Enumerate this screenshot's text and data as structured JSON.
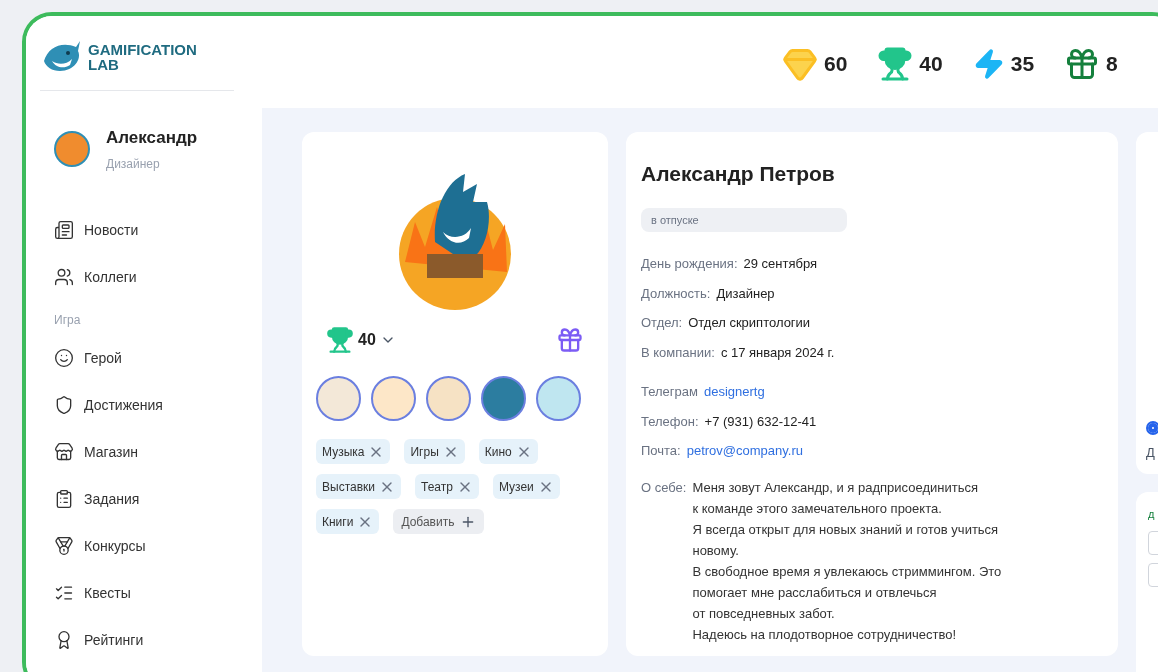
{
  "logo": {
    "line1": "GAMIFICATION",
    "line2": "LAB"
  },
  "user": {
    "name": "Александр",
    "role": "Дизайнер"
  },
  "nav": [
    {
      "items": [
        {
          "label": "Новости"
        },
        {
          "label": "Коллеги"
        }
      ]
    },
    {
      "label": "Игра",
      "items": [
        {
          "label": "Герой"
        },
        {
          "label": "Достижения"
        },
        {
          "label": "Магазин"
        },
        {
          "label": "Задания"
        },
        {
          "label": "Конкурсы"
        },
        {
          "label": "Квесты"
        },
        {
          "label": "Рейтинги"
        }
      ]
    }
  ],
  "counters": [
    {
      "kind": "gem",
      "value": "60"
    },
    {
      "kind": "trophy",
      "value": "40"
    },
    {
      "kind": "bolt",
      "value": "35"
    },
    {
      "kind": "gift",
      "value": "8"
    }
  ],
  "profile": {
    "trophies": "40",
    "tags": [
      {
        "label": "Музыка"
      },
      {
        "label": "Игры"
      },
      {
        "label": "Кино"
      },
      {
        "label": "Выставки"
      },
      {
        "label": "Театр"
      },
      {
        "label": "Музеи"
      },
      {
        "label": "Книги"
      }
    ],
    "add_label": "Добавить"
  },
  "info": {
    "name": "Александр Петров",
    "status": "в отпуске",
    "fields": [
      {
        "label": "День рождения:",
        "value": "29 сентября"
      },
      {
        "label": "Должность:",
        "value": "Дизайнер"
      },
      {
        "label": "Отдел:",
        "value": "Отдел скриптологии"
      },
      {
        "label": "В компании:",
        "value": "с 17 января 2024 г."
      }
    ],
    "contacts": [
      {
        "label": "Телеграм",
        "value": "designertg",
        "kind": "link"
      },
      {
        "label": "Телефон:",
        "value": "+7 (931) 632-12-41",
        "kind": "text"
      },
      {
        "label": "Почта:",
        "value": "petrov@company.ru",
        "kind": "link"
      }
    ],
    "about_label": "О себе:",
    "about_lines": [
      "Меня зовут Александр, и я радприсоединиться",
      "к команде этого замечательного проекта.",
      "Я всегда открыт для новых знаний и готов учиться",
      "новому.",
      "В свободное время я увлекаюсь стриммингом. Это",
      "помогает мне расслабиться и отвлечься",
      "от повседневных забот.",
      "Надеюсь на плодотворное сотрудничество!"
    ]
  },
  "side_panel": {
    "radio_checked": true,
    "text": "Д",
    "second_text": "д"
  }
}
